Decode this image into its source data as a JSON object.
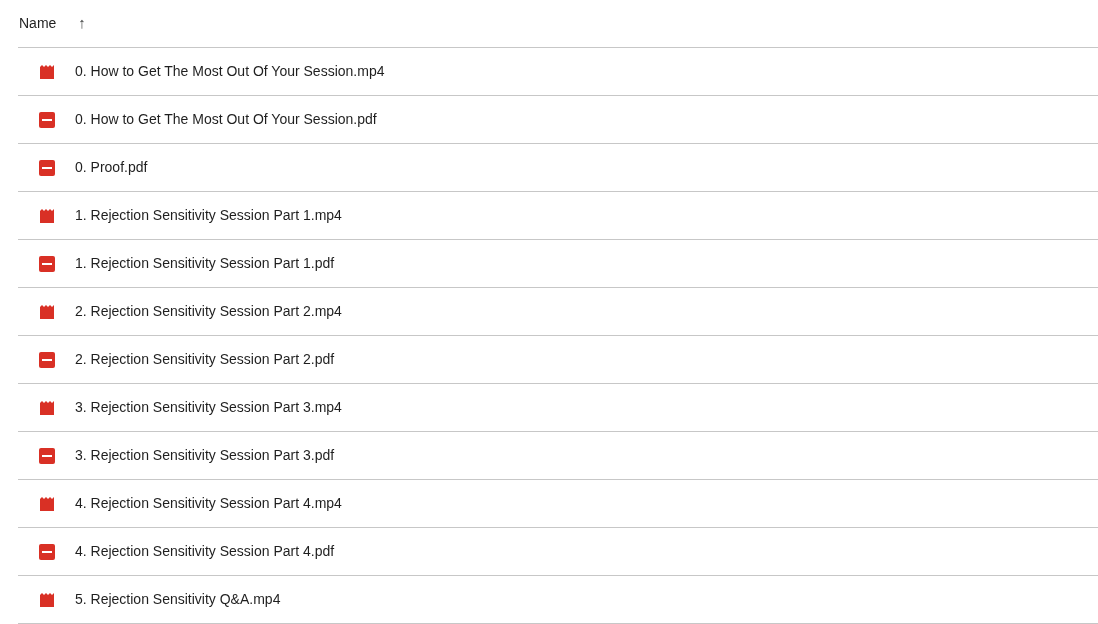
{
  "header": {
    "column": "Name",
    "sort_arrow": "↑"
  },
  "files": [
    {
      "kind": "video",
      "name": "0. How to Get The Most Out Of Your Session.mp4"
    },
    {
      "kind": "pdf",
      "name": "0. How to Get The Most Out Of Your Session.pdf"
    },
    {
      "kind": "pdf",
      "name": "0. Proof.pdf"
    },
    {
      "kind": "video",
      "name": "1. Rejection Sensitivity Session Part 1.mp4"
    },
    {
      "kind": "pdf",
      "name": "1. Rejection Sensitivity Session Part 1.pdf"
    },
    {
      "kind": "video",
      "name": "2. Rejection Sensitivity Session Part 2.mp4"
    },
    {
      "kind": "pdf",
      "name": "2. Rejection Sensitivity Session Part 2.pdf"
    },
    {
      "kind": "video",
      "name": "3. Rejection Sensitivity Session Part 3.mp4"
    },
    {
      "kind": "pdf",
      "name": "3. Rejection Sensitivity Session Part 3.pdf"
    },
    {
      "kind": "video",
      "name": "4. Rejection Sensitivity Session Part 4.mp4"
    },
    {
      "kind": "pdf",
      "name": "4. Rejection Sensitivity Session Part 4.pdf"
    },
    {
      "kind": "video",
      "name": "5. Rejection Sensitivity Q&A.mp4"
    }
  ]
}
